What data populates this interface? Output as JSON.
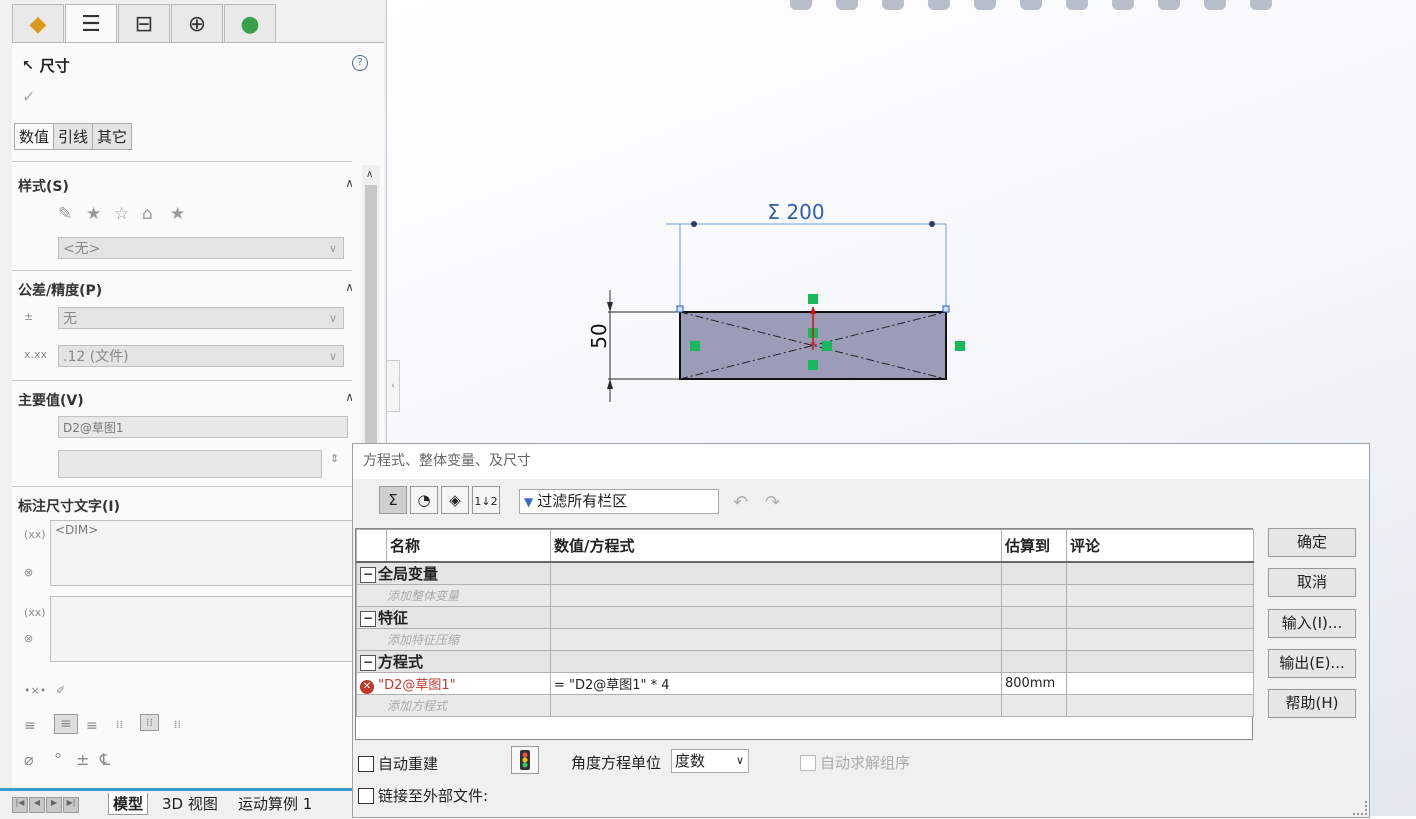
{
  "property_manager": {
    "tabs": [
      "feature-manager",
      "property-manager",
      "configuration-manager",
      "dimxpert-manager",
      "display-manager"
    ],
    "title": "尺寸",
    "help": "?",
    "sub_tabs": [
      "数值",
      "引线",
      "其它"
    ],
    "sections": {
      "style": {
        "label": "样式(S)",
        "combo_value": "<无>"
      },
      "tolerance": {
        "label": "公差/精度(P)",
        "tolerance_value": "无",
        "precision_value": ".12 (文件)"
      },
      "primary_value": {
        "label": "主要值(V)",
        "name": "D2@草图1"
      },
      "dim_text": {
        "label": "标注尺寸文字(I)",
        "text": "<DIM>"
      }
    }
  },
  "bottom_tabs": [
    "模型",
    "3D 视图",
    "运动算例 1"
  ],
  "sketch": {
    "dimension_horizontal": "Σ 200",
    "dimension_vertical": "50"
  },
  "equations_dialog": {
    "title": "方程式、整体变量、及尺寸",
    "filter_placeholder": "过滤所有栏区",
    "columns": [
      "名称",
      "数值/方程式",
      "估算到",
      "评论"
    ],
    "groups": [
      {
        "name": "全局变量",
        "placeholder": "添加整体变量"
      },
      {
        "name": "特征",
        "placeholder": "添加特征压缩"
      },
      {
        "name": "方程式",
        "placeholder": "添加方程式"
      }
    ],
    "equation_row": {
      "name": "\"D2@草图1\"",
      "value": "= \"D2@草图1\" * 4",
      "evaluates_to": "800mm",
      "comment": ""
    },
    "buttons": {
      "ok": "确定",
      "cancel": "取消",
      "import": "输入(I)...",
      "export": "输出(E)...",
      "help": "帮助(H)"
    },
    "auto_rebuild": "自动重建",
    "angle_unit_label": "角度方程单位",
    "angle_unit_value": "度数",
    "auto_solve": "自动求解组序",
    "link_external": "链接至外部文件:"
  }
}
